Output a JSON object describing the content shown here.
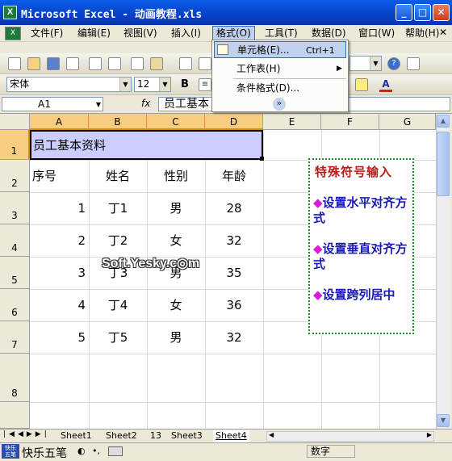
{
  "window": {
    "title": "Microsoft Excel - 动画教程.xls",
    "app_icon_glyph": "X"
  },
  "menu": {
    "items": [
      "文件(F)",
      "编辑(E)",
      "视图(V)",
      "插入(I)",
      "格式(O)",
      "工具(T)",
      "数据(D)",
      "窗口(W)",
      "帮助(H)"
    ],
    "active": "格式(O)"
  },
  "format_menu": {
    "items": [
      {
        "label": "单元格(E)...",
        "shortcut": "Ctrl+1"
      },
      {
        "label": "工作表(H)",
        "submenu": true
      },
      {
        "label": "条件格式(D)..."
      }
    ],
    "expand_glyph": "»"
  },
  "format_toolbar": {
    "font": "宋体",
    "size": "12",
    "bold": "B"
  },
  "formula_bar": {
    "name_box": "A1",
    "fx": "fx",
    "content": "员工基本"
  },
  "grid": {
    "columns": [
      "A",
      "B",
      "C",
      "D",
      "E",
      "F",
      "G"
    ],
    "rows": [
      "1",
      "2",
      "3",
      "4",
      "5",
      "6",
      "7",
      "8"
    ],
    "title": "员工基本资料",
    "headers": [
      "序号",
      "姓名",
      "性别",
      "年龄"
    ],
    "records": [
      {
        "id": "1",
        "name": "丁1",
        "gender": "男",
        "age": "28"
      },
      {
        "id": "2",
        "name": "丁2",
        "gender": "女",
        "age": "32"
      },
      {
        "id": "3",
        "name": "丁3",
        "gender": "男",
        "age": "35"
      },
      {
        "id": "4",
        "name": "丁4",
        "gender": "女",
        "age": "36"
      },
      {
        "id": "5",
        "name": "丁5",
        "gender": "男",
        "age": "32"
      }
    ]
  },
  "note_box": {
    "heading": "特殊符号输入",
    "bullet": "◆",
    "items": [
      "设置水平对齐方式",
      "设置垂直对齐方式",
      "设置跨列居中"
    ]
  },
  "watermark": "Soft.Yesky.c◎m",
  "sheet_tabs": {
    "tabs": [
      "Sheet1",
      "Sheet2",
      "13",
      "Sheet3",
      "Sheet4"
    ],
    "active": "Sheet4"
  },
  "status": {
    "ime_name": "快乐五笔",
    "ime_badge": "快乐 五笔",
    "mode": "数字"
  },
  "colors": {
    "title_cell_bg": "#ccccff",
    "note_text": "#1a1ab5",
    "note_heading": "#c01818",
    "note_border": "#1b8a2c"
  }
}
